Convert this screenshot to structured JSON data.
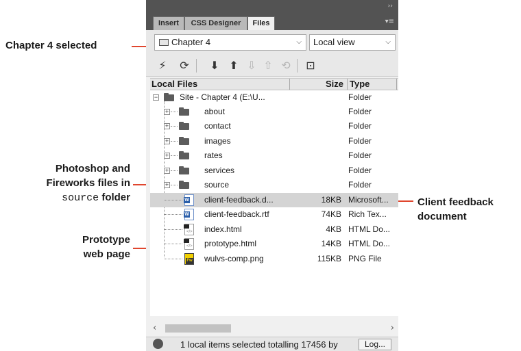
{
  "callouts": {
    "chapter_selected": "Chapter 4 selected",
    "ps_fw_line1": "Photoshop and",
    "ps_fw_line2": "Fireworks files in",
    "ps_fw_line3_code": "source",
    "ps_fw_line3_rest": " folder",
    "prototype_line1": "Prototype",
    "prototype_line2": "web page",
    "client_line1": "Client feedback",
    "client_line2": "document",
    "line_color": "#e0462e"
  },
  "panel": {
    "tabs": [
      {
        "label": "Insert",
        "active": false
      },
      {
        "label": "CSS Designer",
        "active": false
      },
      {
        "label": "Files",
        "active": true
      }
    ],
    "site_select": "Chapter 4",
    "view_select": "Local view",
    "toolbar_icons": [
      "connect-icon",
      "refresh-icon",
      "get-files-icon",
      "put-files-icon",
      "check-out-icon",
      "check-in-icon",
      "synchronize-icon",
      "expand-icon"
    ],
    "columns": {
      "name": "Local Files",
      "size": "Size",
      "type": "Type"
    },
    "root": {
      "name": "Site - Chapter 4 (E:\\U...",
      "type": "Folder"
    },
    "folders": [
      {
        "name": "about",
        "type": "Folder"
      },
      {
        "name": "contact",
        "type": "Folder"
      },
      {
        "name": "images",
        "type": "Folder"
      },
      {
        "name": "rates",
        "type": "Folder"
      },
      {
        "name": "services",
        "type": "Folder"
      },
      {
        "name": "source",
        "type": "Folder"
      }
    ],
    "files": [
      {
        "name": "client-feedback.d...",
        "size": "18KB",
        "type": "Microsoft...",
        "icon": "word-doc-icon",
        "selected": true
      },
      {
        "name": "client-feedback.rtf",
        "size": "74KB",
        "type": "Rich Tex...",
        "icon": "word-doc-icon",
        "selected": false
      },
      {
        "name": "index.html",
        "size": "4KB",
        "type": "HTML Do...",
        "icon": "html-file-icon",
        "selected": false
      },
      {
        "name": "prototype.html",
        "size": "14KB",
        "type": "HTML Do...",
        "icon": "html-file-icon",
        "selected": false
      },
      {
        "name": "wulvs-comp.png",
        "size": "115KB",
        "type": "PNG File",
        "icon": "fireworks-png-icon",
        "selected": false
      }
    ],
    "status": "1 local items selected totalling 17456 by",
    "log_button": "Log..."
  }
}
